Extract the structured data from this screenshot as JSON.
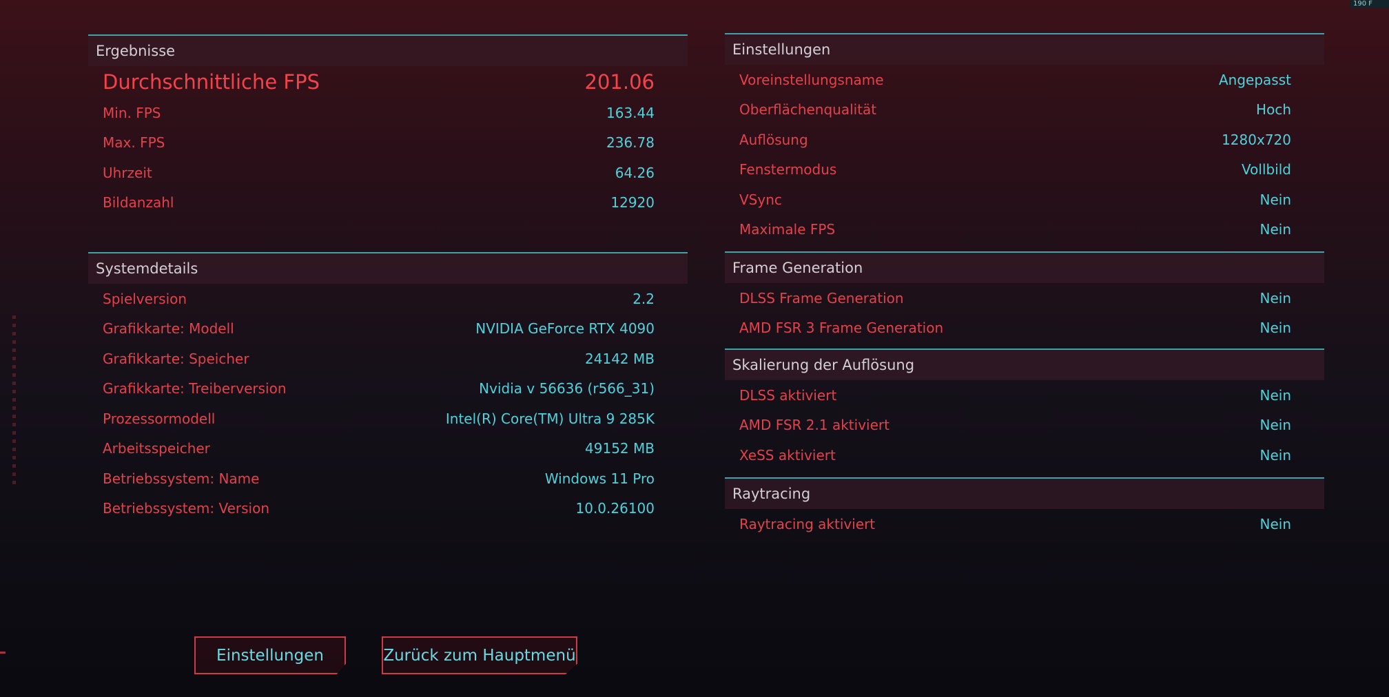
{
  "overlay": {
    "fps_text": "190 F"
  },
  "results": {
    "title": "Ergebnisse",
    "rows": [
      {
        "label": "Durchschnittliche FPS",
        "value": "201.06"
      },
      {
        "label": "Min. FPS",
        "value": "163.44"
      },
      {
        "label": "Max. FPS",
        "value": "236.78"
      },
      {
        "label": "Uhrzeit",
        "value": "64.26"
      },
      {
        "label": "Bildanzahl",
        "value": "12920"
      }
    ]
  },
  "system": {
    "title": "Systemdetails",
    "rows": [
      {
        "label": "Spielversion",
        "value": "2.2"
      },
      {
        "label": "Grafikkarte: Modell",
        "value": "NVIDIA GeForce RTX 4090"
      },
      {
        "label": "Grafikkarte: Speicher",
        "value": "24142 MB"
      },
      {
        "label": "Grafikkarte: Treiberversion",
        "value": "Nvidia v 56636 (r566_31)"
      },
      {
        "label": "Prozessormodell",
        "value": "Intel(R) Core(TM) Ultra 9 285K"
      },
      {
        "label": "Arbeitsspeicher",
        "value": "49152 MB"
      },
      {
        "label": "Betriebssystem: Name",
        "value": "Windows 11 Pro"
      },
      {
        "label": "Betriebssystem: Version",
        "value": "10.0.26100"
      }
    ]
  },
  "settings": {
    "title": "Einstellungen",
    "rows": [
      {
        "label": "Voreinstellungsname",
        "value": "Angepasst"
      },
      {
        "label": "Oberflächenqualität",
        "value": "Hoch"
      },
      {
        "label": "Auflösung",
        "value": "1280x720"
      },
      {
        "label": "Fenstermodus",
        "value": "Vollbild"
      },
      {
        "label": "VSync",
        "value": "Nein"
      },
      {
        "label": "Maximale FPS",
        "value": "Nein"
      }
    ]
  },
  "frame_generation": {
    "title": "Frame Generation",
    "rows": [
      {
        "label": "DLSS Frame Generation",
        "value": "Nein"
      },
      {
        "label": "AMD FSR 3 Frame Generation",
        "value": "Nein"
      }
    ]
  },
  "scaling": {
    "title": "Skalierung der Auflösung",
    "rows": [
      {
        "label": "DLSS aktiviert",
        "value": "Nein"
      },
      {
        "label": "AMD FSR 2.1 aktiviert",
        "value": "Nein"
      },
      {
        "label": "XeSS aktiviert",
        "value": "Nein"
      }
    ]
  },
  "raytracing": {
    "title": "Raytracing",
    "rows": [
      {
        "label": "Raytracing aktiviert",
        "value": "Nein"
      }
    ]
  },
  "buttons": {
    "settings_label": "Einstellungen",
    "main_menu_label": "Zurück zum Hauptmenü"
  },
  "colors": {
    "accent_red": "#e5414b",
    "accent_cyan": "#4ed2dc",
    "divider_teal": "#3da4ae"
  }
}
